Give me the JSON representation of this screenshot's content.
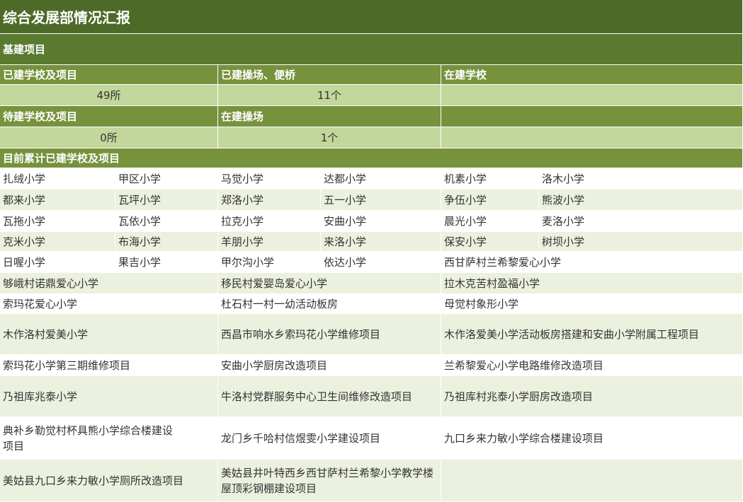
{
  "title": "综合发展部情况汇报",
  "section_infra": "基建项目",
  "headers": {
    "built": "已建学校及项目",
    "playground_bridge": "已建操场、便桥",
    "building_school": "在建学校",
    "pending": "待建学校及项目",
    "building_playground": "在建操场"
  },
  "values": {
    "built": "49所",
    "playground_bridge": "11个",
    "building_school": "",
    "pending": "0所",
    "building_playground": "1个",
    "extra": ""
  },
  "section_cumulative": "目前累计已建学校及项目",
  "grid_rows": [
    [
      "扎绒小学",
      "甲区小学",
      "马觉小学",
      "达都小学",
      "机素小学",
      "洛木小学"
    ],
    [
      "都来小学",
      "瓦坪小学",
      "郑洛小学",
      "五一小学",
      "争伍小学",
      "熊波小学"
    ],
    [
      "瓦拖小学",
      "瓦依小学",
      "拉克小学",
      "安曲小学",
      "晨光小学",
      "麦洛小学"
    ],
    [
      "克米小学",
      "布海小学",
      "羊朋小学",
      "来洛小学",
      "保安小学",
      "树坝小学"
    ],
    [
      "日喔小学",
      "果吉小学",
      "甲尔沟小学",
      "依达小学",
      "西甘萨村兰希黎爱心小学"
    ]
  ],
  "wide_rows": [
    [
      "够峨村诺鼎爱心小学",
      "移民村爱婴岛爱心小学",
      "拉木克苦村盈福小学"
    ],
    [
      "索玛花爱心小学",
      "杜石村一村一幼活动板房",
      "母觉村象形小学"
    ],
    [
      "木作洛村爱美小学",
      "西昌市响水乡索玛花小学维修项目",
      "木作洛爱美小学活动板房搭建和安曲小学附属工程项目"
    ],
    [
      "索玛花小学第三期维修项目",
      "安曲小学厨房改造项目",
      "兰希黎爱心小学电路维修改造项目"
    ],
    [
      "乃祖库兆泰小学",
      "牛洛村党群服务中心卫生间维修改造项目",
      "乃祖库村兆泰小学厨房改造项目"
    ],
    [
      "典补乡勒觉村杯具熊小学综合楼建设项目",
      "龙门乡千哈村信煜雯小学建设项目",
      "九口乡来力敏小学综合楼建设项目"
    ],
    [
      "美姑县九口乡来力敏小学厕所改造项目",
      "美姑县井叶特西乡西甘萨村兰希黎小学教学楼屋顶彩钢棚建设项目",
      ""
    ]
  ]
}
